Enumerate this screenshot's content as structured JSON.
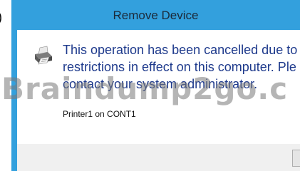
{
  "dialog": {
    "title": "Remove Device",
    "message_line1": "This operation has been cancelled due to",
    "message_line2": "restrictions in effect on this computer. Ple",
    "message_line3": "contact your system administrator.",
    "device_label": "Printer1 on CONT1",
    "icon": "printer-icon"
  },
  "left_edge": {
    "glyph": ")"
  },
  "watermark": {
    "text": "Braindump2go.c"
  },
  "colors": {
    "frame": "#33a0dd",
    "message_text": "#1e3a8c",
    "footer": "#f0f0f0"
  }
}
